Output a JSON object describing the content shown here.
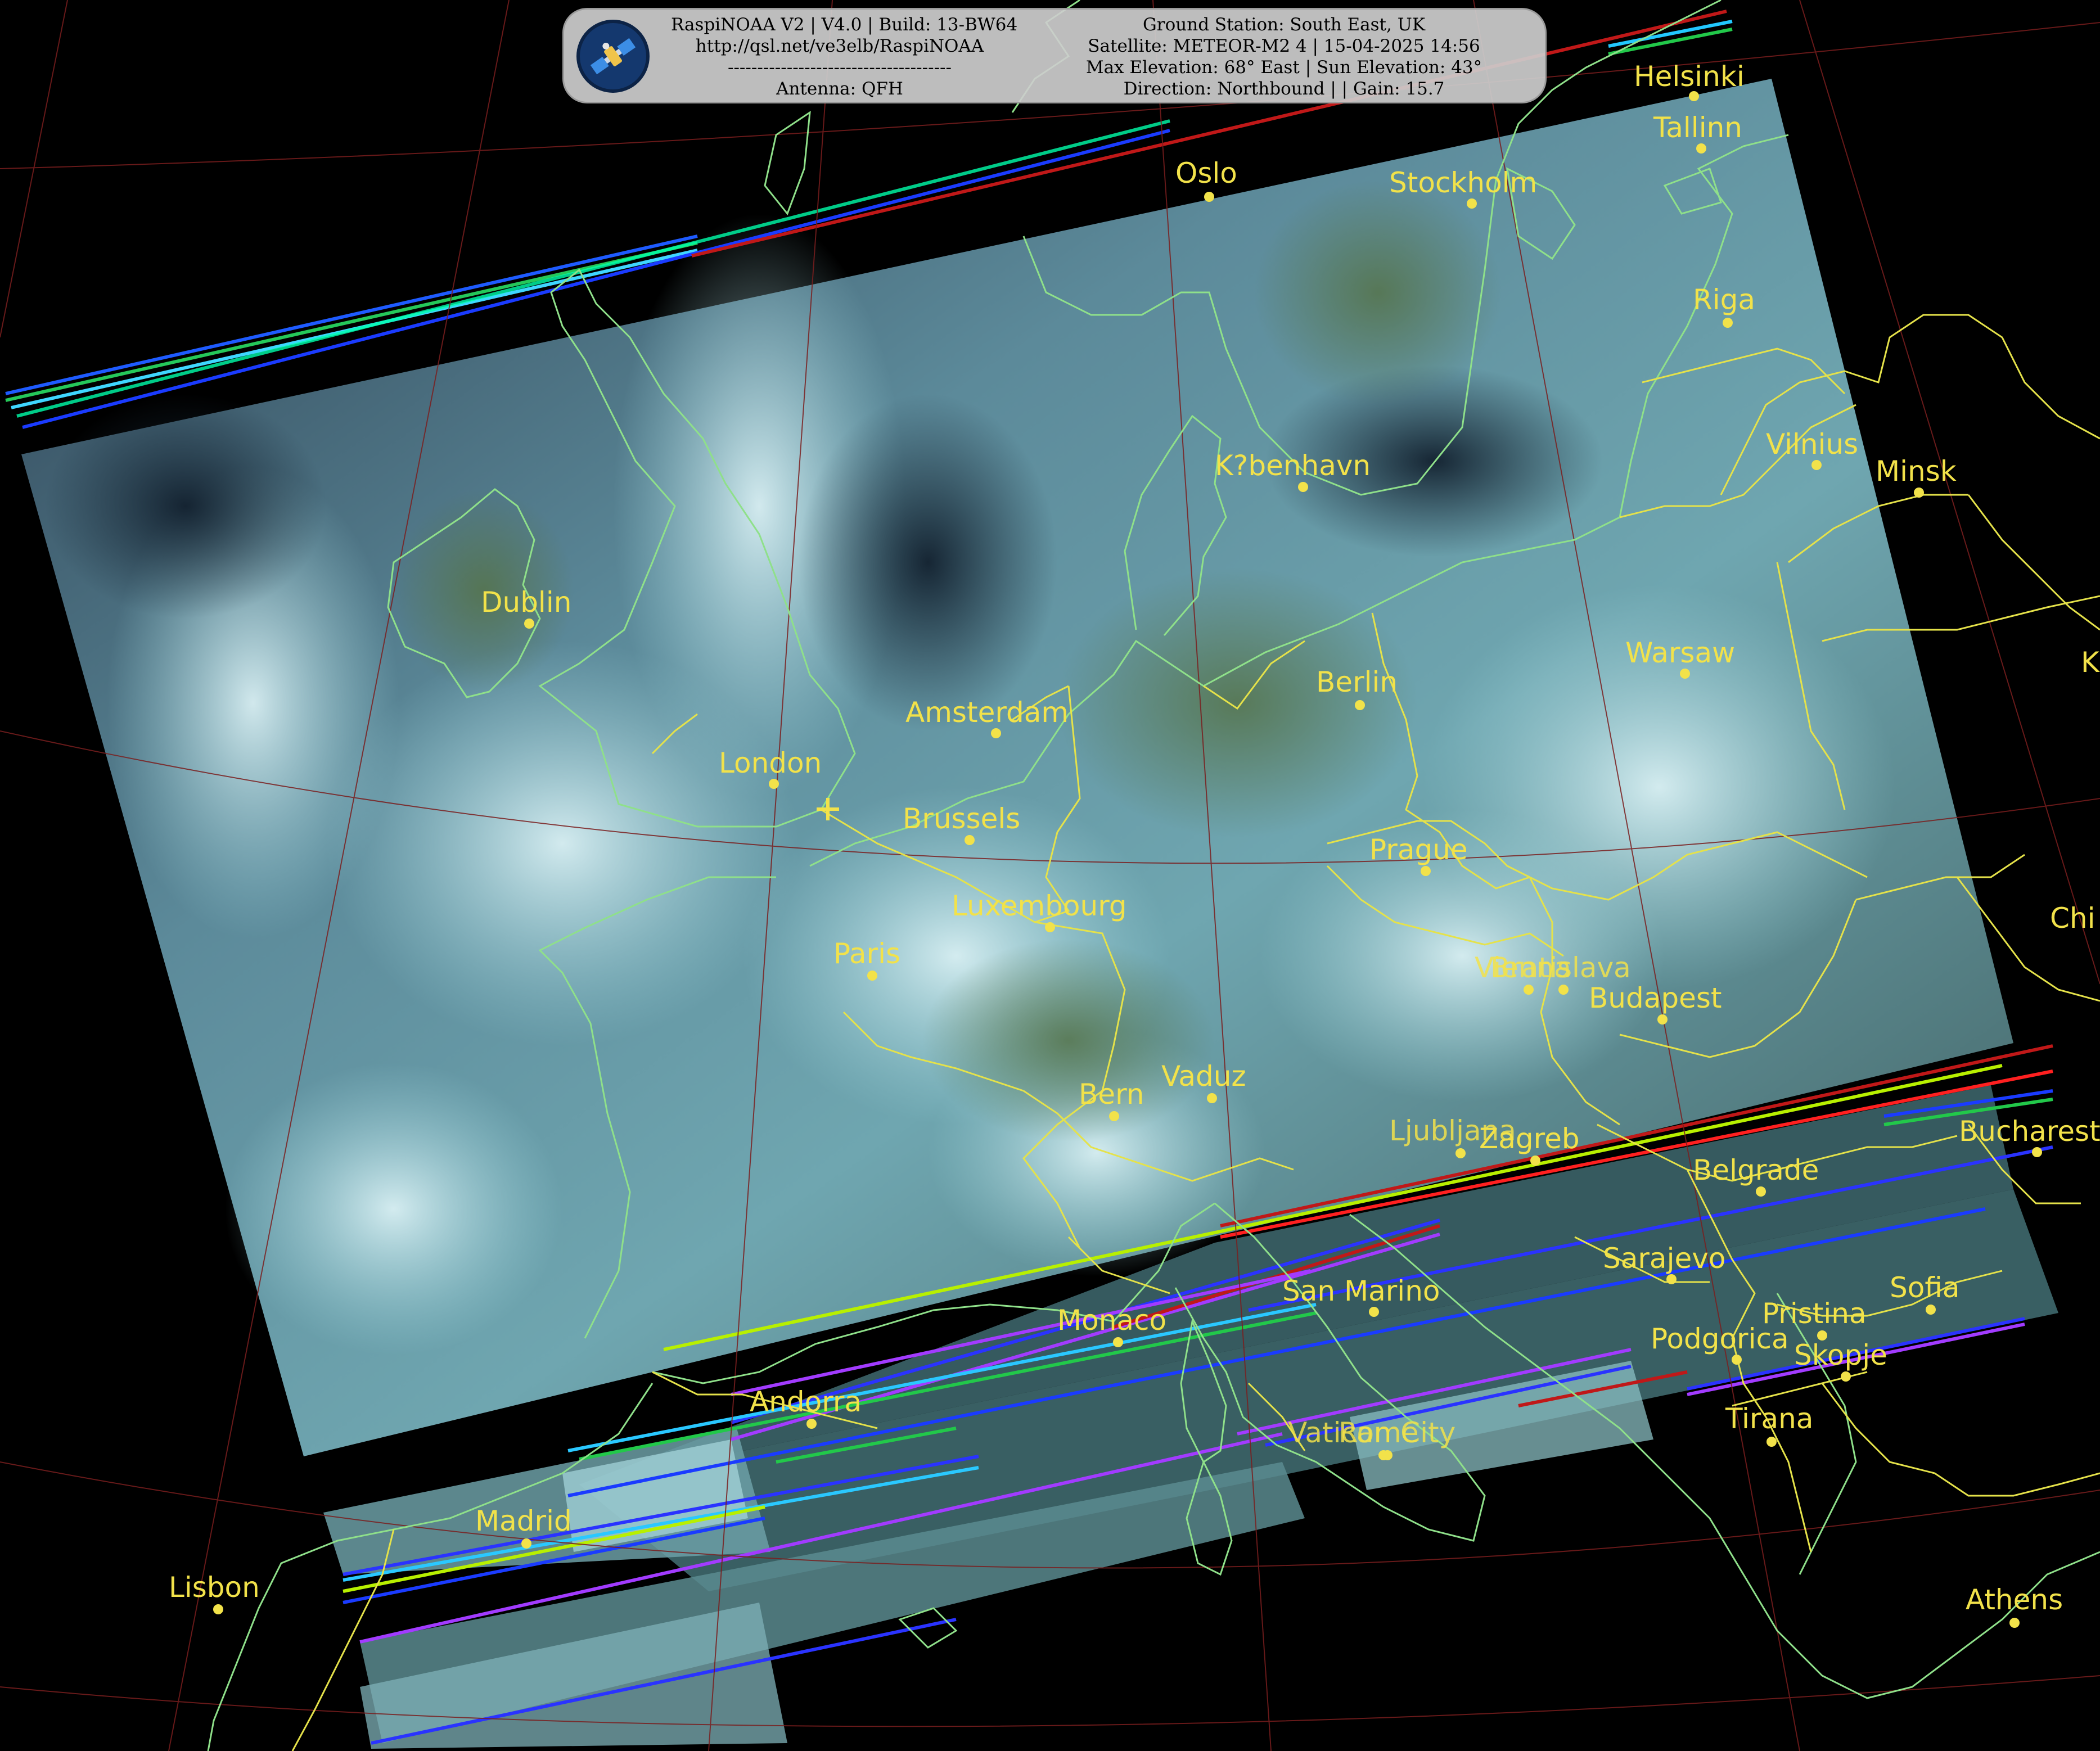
{
  "header": {
    "left_lines": [
      "RaspiNOAA V2 | V4.0 | Build: 13-BW64",
      "http://qsl.net/ve3elb/RaspiNOAA",
      "--------------------------------------",
      "Antenna: QFH"
    ],
    "right_lines": [
      "Ground Station: South East, UK",
      "Satellite: METEOR-M2 4 | 15-04-2025 14:56",
      "Max Elevation: 68° East | Sun Elevation: 43°",
      "Direction: Northbound | | Gain: 15.7"
    ]
  },
  "cities": [
    {
      "name": "Helsinki"
    },
    {
      "name": "Tallinn"
    },
    {
      "name": "Oslo"
    },
    {
      "name": "Stockholm"
    },
    {
      "name": "Riga"
    },
    {
      "name": "Vilnius"
    },
    {
      "name": "Minsk"
    },
    {
      "name": "K?benhavn"
    },
    {
      "name": "Dublin"
    },
    {
      "name": "Warsaw"
    },
    {
      "name": "Berlin"
    },
    {
      "name": "Amsterdam"
    },
    {
      "name": "London"
    },
    {
      "name": "Brussels"
    },
    {
      "name": "Prague"
    },
    {
      "name": "Luxembourg"
    },
    {
      "name": "Paris"
    },
    {
      "name": "Vienna"
    },
    {
      "name": "Bratislava"
    },
    {
      "name": "Budapest"
    },
    {
      "name": "Vaduz"
    },
    {
      "name": "Bern"
    },
    {
      "name": "Ljubljana"
    },
    {
      "name": "Zagreb"
    },
    {
      "name": "Bucharest"
    },
    {
      "name": "Belgrade"
    },
    {
      "name": "Sarajevo"
    },
    {
      "name": "San Marino"
    },
    {
      "name": "Sofia"
    },
    {
      "name": "Monaco"
    },
    {
      "name": "Pristina"
    },
    {
      "name": "Podgorica"
    },
    {
      "name": "Skopje"
    },
    {
      "name": "Andorra"
    },
    {
      "name": "Tirana"
    },
    {
      "name": "Vatican City"
    },
    {
      "name": "Rome"
    },
    {
      "name": "Madrid"
    },
    {
      "name": "Lisbon"
    },
    {
      "name": "Athens"
    },
    {
      "name": "Chi"
    },
    {
      "name": "K"
    }
  ],
  "colors": {
    "label": "#f2e24a",
    "coastline": "#8fe08a",
    "borders": "#e5e24a",
    "graticule": "#7a1e1e"
  },
  "icons": {
    "logo": "satellite-logo-icon",
    "ground_station": "plus-marker-icon"
  }
}
